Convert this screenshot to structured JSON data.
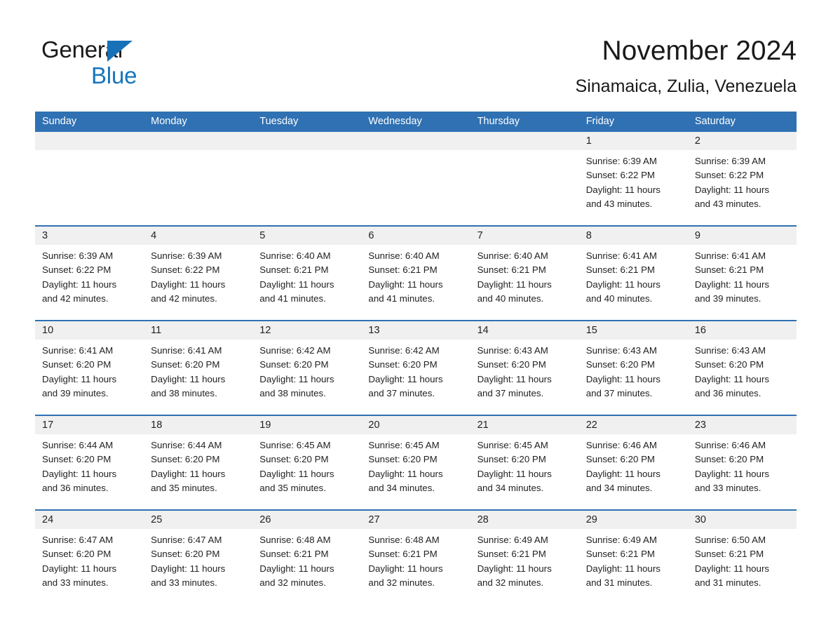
{
  "brand": {
    "name_part1": "General",
    "name_part2": "Blue",
    "accent_color": "#1775bc",
    "header_color": "#2f71b3"
  },
  "header": {
    "month_title": "November 2024",
    "location": "Sinamaica, Zulia, Venezuela"
  },
  "calendar": {
    "weekdays": [
      "Sunday",
      "Monday",
      "Tuesday",
      "Wednesday",
      "Thursday",
      "Friday",
      "Saturday"
    ],
    "weeks": [
      [
        {
          "day": "",
          "sunrise": "",
          "sunset": "",
          "daylight": "",
          "daylight2": "",
          "empty": true
        },
        {
          "day": "",
          "sunrise": "",
          "sunset": "",
          "daylight": "",
          "daylight2": "",
          "empty": true
        },
        {
          "day": "",
          "sunrise": "",
          "sunset": "",
          "daylight": "",
          "daylight2": "",
          "empty": true
        },
        {
          "day": "",
          "sunrise": "",
          "sunset": "",
          "daylight": "",
          "daylight2": "",
          "empty": true
        },
        {
          "day": "",
          "sunrise": "",
          "sunset": "",
          "daylight": "",
          "daylight2": "",
          "empty": true
        },
        {
          "day": "1",
          "sunrise": "Sunrise: 6:39 AM",
          "sunset": "Sunset: 6:22 PM",
          "daylight": "Daylight: 11 hours",
          "daylight2": "and 43 minutes.",
          "empty": false
        },
        {
          "day": "2",
          "sunrise": "Sunrise: 6:39 AM",
          "sunset": "Sunset: 6:22 PM",
          "daylight": "Daylight: 11 hours",
          "daylight2": "and 43 minutes.",
          "empty": false
        }
      ],
      [
        {
          "day": "3",
          "sunrise": "Sunrise: 6:39 AM",
          "sunset": "Sunset: 6:22 PM",
          "daylight": "Daylight: 11 hours",
          "daylight2": "and 42 minutes.",
          "empty": false
        },
        {
          "day": "4",
          "sunrise": "Sunrise: 6:39 AM",
          "sunset": "Sunset: 6:22 PM",
          "daylight": "Daylight: 11 hours",
          "daylight2": "and 42 minutes.",
          "empty": false
        },
        {
          "day": "5",
          "sunrise": "Sunrise: 6:40 AM",
          "sunset": "Sunset: 6:21 PM",
          "daylight": "Daylight: 11 hours",
          "daylight2": "and 41 minutes.",
          "empty": false
        },
        {
          "day": "6",
          "sunrise": "Sunrise: 6:40 AM",
          "sunset": "Sunset: 6:21 PM",
          "daylight": "Daylight: 11 hours",
          "daylight2": "and 41 minutes.",
          "empty": false
        },
        {
          "day": "7",
          "sunrise": "Sunrise: 6:40 AM",
          "sunset": "Sunset: 6:21 PM",
          "daylight": "Daylight: 11 hours",
          "daylight2": "and 40 minutes.",
          "empty": false
        },
        {
          "day": "8",
          "sunrise": "Sunrise: 6:41 AM",
          "sunset": "Sunset: 6:21 PM",
          "daylight": "Daylight: 11 hours",
          "daylight2": "and 40 minutes.",
          "empty": false
        },
        {
          "day": "9",
          "sunrise": "Sunrise: 6:41 AM",
          "sunset": "Sunset: 6:21 PM",
          "daylight": "Daylight: 11 hours",
          "daylight2": "and 39 minutes.",
          "empty": false
        }
      ],
      [
        {
          "day": "10",
          "sunrise": "Sunrise: 6:41 AM",
          "sunset": "Sunset: 6:20 PM",
          "daylight": "Daylight: 11 hours",
          "daylight2": "and 39 minutes.",
          "empty": false
        },
        {
          "day": "11",
          "sunrise": "Sunrise: 6:41 AM",
          "sunset": "Sunset: 6:20 PM",
          "daylight": "Daylight: 11 hours",
          "daylight2": "and 38 minutes.",
          "empty": false
        },
        {
          "day": "12",
          "sunrise": "Sunrise: 6:42 AM",
          "sunset": "Sunset: 6:20 PM",
          "daylight": "Daylight: 11 hours",
          "daylight2": "and 38 minutes.",
          "empty": false
        },
        {
          "day": "13",
          "sunrise": "Sunrise: 6:42 AM",
          "sunset": "Sunset: 6:20 PM",
          "daylight": "Daylight: 11 hours",
          "daylight2": "and 37 minutes.",
          "empty": false
        },
        {
          "day": "14",
          "sunrise": "Sunrise: 6:43 AM",
          "sunset": "Sunset: 6:20 PM",
          "daylight": "Daylight: 11 hours",
          "daylight2": "and 37 minutes.",
          "empty": false
        },
        {
          "day": "15",
          "sunrise": "Sunrise: 6:43 AM",
          "sunset": "Sunset: 6:20 PM",
          "daylight": "Daylight: 11 hours",
          "daylight2": "and 37 minutes.",
          "empty": false
        },
        {
          "day": "16",
          "sunrise": "Sunrise: 6:43 AM",
          "sunset": "Sunset: 6:20 PM",
          "daylight": "Daylight: 11 hours",
          "daylight2": "and 36 minutes.",
          "empty": false
        }
      ],
      [
        {
          "day": "17",
          "sunrise": "Sunrise: 6:44 AM",
          "sunset": "Sunset: 6:20 PM",
          "daylight": "Daylight: 11 hours",
          "daylight2": "and 36 minutes.",
          "empty": false
        },
        {
          "day": "18",
          "sunrise": "Sunrise: 6:44 AM",
          "sunset": "Sunset: 6:20 PM",
          "daylight": "Daylight: 11 hours",
          "daylight2": "and 35 minutes.",
          "empty": false
        },
        {
          "day": "19",
          "sunrise": "Sunrise: 6:45 AM",
          "sunset": "Sunset: 6:20 PM",
          "daylight": "Daylight: 11 hours",
          "daylight2": "and 35 minutes.",
          "empty": false
        },
        {
          "day": "20",
          "sunrise": "Sunrise: 6:45 AM",
          "sunset": "Sunset: 6:20 PM",
          "daylight": "Daylight: 11 hours",
          "daylight2": "and 34 minutes.",
          "empty": false
        },
        {
          "day": "21",
          "sunrise": "Sunrise: 6:45 AM",
          "sunset": "Sunset: 6:20 PM",
          "daylight": "Daylight: 11 hours",
          "daylight2": "and 34 minutes.",
          "empty": false
        },
        {
          "day": "22",
          "sunrise": "Sunrise: 6:46 AM",
          "sunset": "Sunset: 6:20 PM",
          "daylight": "Daylight: 11 hours",
          "daylight2": "and 34 minutes.",
          "empty": false
        },
        {
          "day": "23",
          "sunrise": "Sunrise: 6:46 AM",
          "sunset": "Sunset: 6:20 PM",
          "daylight": "Daylight: 11 hours",
          "daylight2": "and 33 minutes.",
          "empty": false
        }
      ],
      [
        {
          "day": "24",
          "sunrise": "Sunrise: 6:47 AM",
          "sunset": "Sunset: 6:20 PM",
          "daylight": "Daylight: 11 hours",
          "daylight2": "and 33 minutes.",
          "empty": false
        },
        {
          "day": "25",
          "sunrise": "Sunrise: 6:47 AM",
          "sunset": "Sunset: 6:20 PM",
          "daylight": "Daylight: 11 hours",
          "daylight2": "and 33 minutes.",
          "empty": false
        },
        {
          "day": "26",
          "sunrise": "Sunrise: 6:48 AM",
          "sunset": "Sunset: 6:21 PM",
          "daylight": "Daylight: 11 hours",
          "daylight2": "and 32 minutes.",
          "empty": false
        },
        {
          "day": "27",
          "sunrise": "Sunrise: 6:48 AM",
          "sunset": "Sunset: 6:21 PM",
          "daylight": "Daylight: 11 hours",
          "daylight2": "and 32 minutes.",
          "empty": false
        },
        {
          "day": "28",
          "sunrise": "Sunrise: 6:49 AM",
          "sunset": "Sunset: 6:21 PM",
          "daylight": "Daylight: 11 hours",
          "daylight2": "and 32 minutes.",
          "empty": false
        },
        {
          "day": "29",
          "sunrise": "Sunrise: 6:49 AM",
          "sunset": "Sunset: 6:21 PM",
          "daylight": "Daylight: 11 hours",
          "daylight2": "and 31 minutes.",
          "empty": false
        },
        {
          "day": "30",
          "sunrise": "Sunrise: 6:50 AM",
          "sunset": "Sunset: 6:21 PM",
          "daylight": "Daylight: 11 hours",
          "daylight2": "and 31 minutes.",
          "empty": false
        }
      ]
    ]
  }
}
